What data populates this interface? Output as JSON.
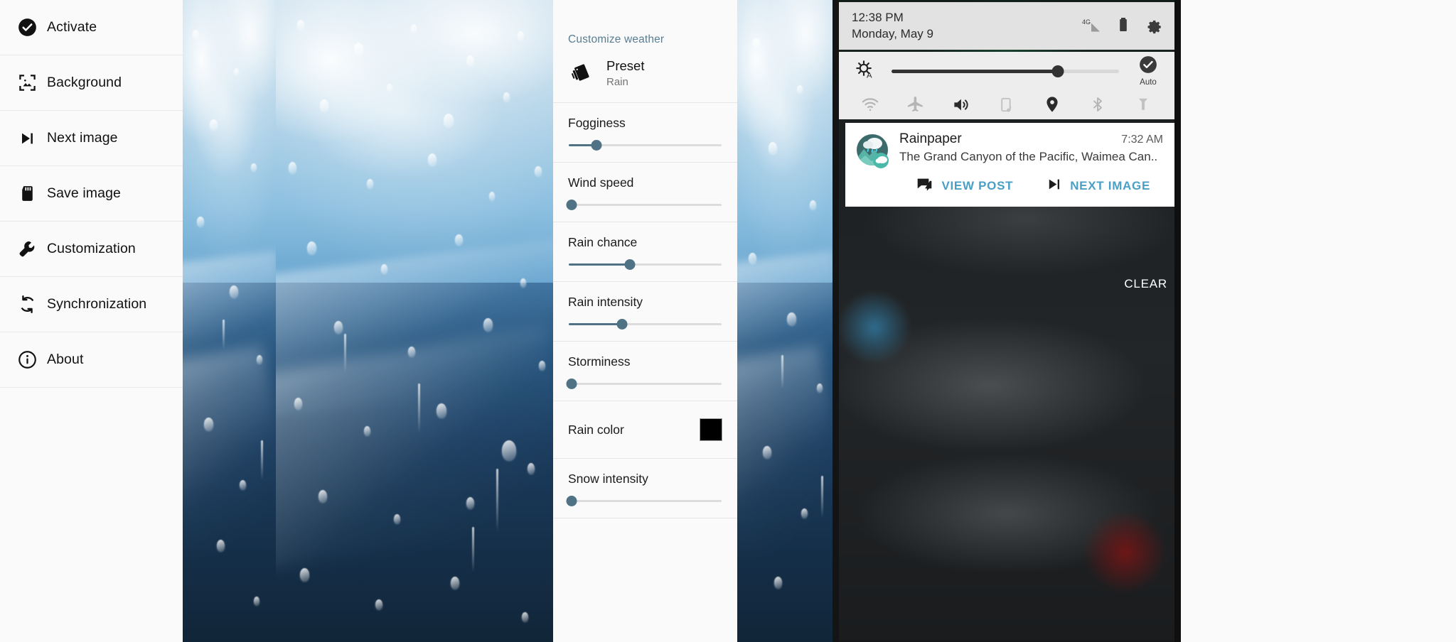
{
  "sidebar": {
    "items": [
      {
        "label": "Activate",
        "icon": "check-circle-icon"
      },
      {
        "label": "Background",
        "icon": "image-frame-icon"
      },
      {
        "label": "Next image",
        "icon": "skip-next-icon"
      },
      {
        "label": "Save image",
        "icon": "sd-card-icon"
      },
      {
        "label": "Customization",
        "icon": "wrench-icon"
      },
      {
        "label": "Synchronization",
        "icon": "sync-icon"
      },
      {
        "label": "About",
        "icon": "info-circle-icon"
      }
    ]
  },
  "weather_panel": {
    "title": "Customize weather",
    "preset": {
      "icon": "preset-card-icon",
      "label": "Preset",
      "value": "Rain"
    },
    "sliders": [
      {
        "label": "Fogginess",
        "percent": 18
      },
      {
        "label": "Wind speed",
        "percent": 2
      },
      {
        "label": "Rain chance",
        "percent": 40
      },
      {
        "label": "Rain intensity",
        "percent": 35
      },
      {
        "label": "Storminess",
        "percent": 2
      },
      {
        "label": "Snow intensity",
        "percent": 2
      }
    ],
    "color_setting": {
      "label": "Rain color",
      "value": "#000000"
    },
    "accent": "#5a7d91",
    "slider_accent": "#4f7285"
  },
  "phone": {
    "status": {
      "time": "12:38 PM",
      "date": "Monday, May 9",
      "signal_label": "4G",
      "icons": [
        "signal-4g-icon",
        "battery-icon",
        "settings-gear-icon"
      ]
    },
    "quick_settings": {
      "brightness_icon": "brightness-auto-icon",
      "brightness_percent": 73,
      "auto_label": "Auto",
      "auto_icon": "check-circle-icon",
      "toggles": [
        {
          "name": "wifi-icon",
          "active": false
        },
        {
          "name": "airplane-mode-icon",
          "active": false
        },
        {
          "name": "volume-icon",
          "active": true
        },
        {
          "name": "auto-rotate-icon",
          "active": false
        },
        {
          "name": "location-pin-icon",
          "active": true
        },
        {
          "name": "bluetooth-icon",
          "active": false
        },
        {
          "name": "flashlight-icon",
          "active": false
        }
      ]
    },
    "notification": {
      "app_name": "Rainpaper",
      "time": "7:32 AM",
      "body": "The Grand Canyon of the Pacific, Waimea Can..",
      "icon": "rainpaper-app-icon",
      "actions": [
        {
          "label": "VIEW POST",
          "icon": "comment-icon"
        },
        {
          "label": "NEXT IMAGE",
          "icon": "skip-next-icon"
        }
      ],
      "action_color": "#4a9fc7"
    },
    "clear_label": "CLEAR"
  }
}
